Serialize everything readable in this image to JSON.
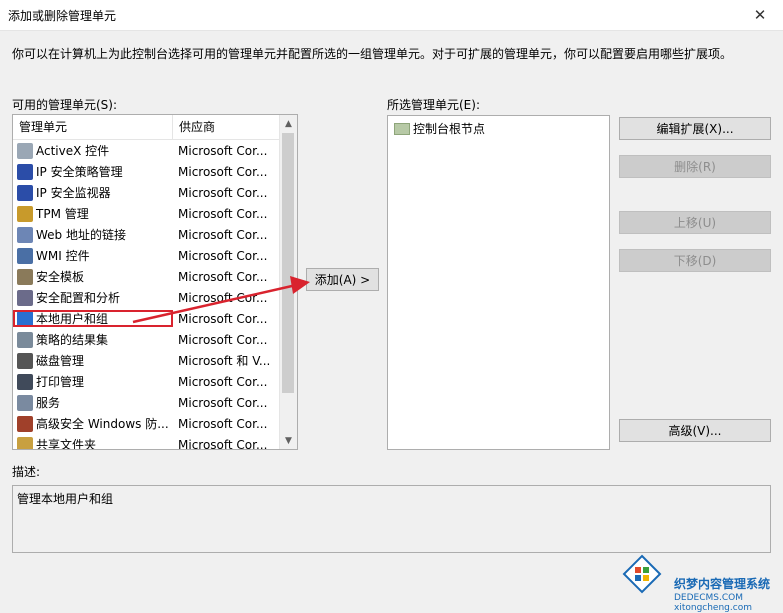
{
  "window": {
    "title": "添加或删除管理单元",
    "close_glyph": "✕"
  },
  "intro_text": "你可以在计算机上为此控制台选择可用的管理单元并配置所选的一组管理单元。对于可扩展的管理单元，你可以配置要启用哪些扩展项。",
  "available": {
    "label": "可用的管理单元(S):",
    "col_name": "管理单元",
    "col_vendor": "供应商",
    "items": [
      {
        "name": "ActiveX 控件",
        "vendor": "Microsoft Cor...",
        "icon": "activex-icon",
        "color": "#9aa7b5"
      },
      {
        "name": "IP 安全策略管理",
        "vendor": "Microsoft Cor...",
        "icon": "ip-security-policy-icon",
        "color": "#2b4da8"
      },
      {
        "name": "IP 安全监视器",
        "vendor": "Microsoft Cor...",
        "icon": "ip-security-monitor-icon",
        "color": "#2b4da8"
      },
      {
        "name": "TPM 管理",
        "vendor": "Microsoft Cor...",
        "icon": "tpm-icon",
        "color": "#c89a2b"
      },
      {
        "name": "Web 地址的链接",
        "vendor": "Microsoft Cor...",
        "icon": "web-link-icon",
        "color": "#6d86b5"
      },
      {
        "name": "WMI 控件",
        "vendor": "Microsoft Cor...",
        "icon": "wmi-icon",
        "color": "#4a6fa5"
      },
      {
        "name": "安全模板",
        "vendor": "Microsoft Cor...",
        "icon": "security-template-icon",
        "color": "#8a7a5a"
      },
      {
        "name": "安全配置和分析",
        "vendor": "Microsoft Cor...",
        "icon": "security-config-icon",
        "color": "#6b6b8a"
      },
      {
        "name": "本地用户和组",
        "vendor": "Microsoft Cor...",
        "icon": "local-users-icon",
        "color": "#2a6fd0"
      },
      {
        "name": "策略的结果集",
        "vendor": "Microsoft Cor...",
        "icon": "rsop-icon",
        "color": "#7a8a9a"
      },
      {
        "name": "磁盘管理",
        "vendor": "Microsoft 和 V...",
        "icon": "disk-management-icon",
        "color": "#555555"
      },
      {
        "name": "打印管理",
        "vendor": "Microsoft Cor...",
        "icon": "print-management-icon",
        "color": "#404a5a"
      },
      {
        "name": "服务",
        "vendor": "Microsoft Cor...",
        "icon": "services-icon",
        "color": "#7a8aa0"
      },
      {
        "name": "高级安全 Windows 防...",
        "vendor": "Microsoft Cor...",
        "icon": "firewall-icon",
        "color": "#a0402a"
      },
      {
        "name": "共享文件夹",
        "vendor": "Microsoft Cor...",
        "icon": "shared-folder-icon",
        "color": "#c8a040"
      }
    ],
    "highlight_index": 8
  },
  "add_button": "添加(A) >",
  "selected": {
    "label": "所选管理单元(E):",
    "root_node": "控制台根节点"
  },
  "buttons": {
    "edit_ext": "编辑扩展(X)...",
    "remove": "删除(R)",
    "move_up": "上移(U)",
    "move_down": "下移(D)",
    "advanced": "高级(V)..."
  },
  "description": {
    "label": "描述:",
    "text": "管理本地用户和组"
  },
  "watermark": {
    "line1": "织梦内容管理系统",
    "line2": "DEDECMS.COM",
    "line3": "xitongcheng.com"
  },
  "colors": {
    "annotation_red": "#d9232e"
  }
}
